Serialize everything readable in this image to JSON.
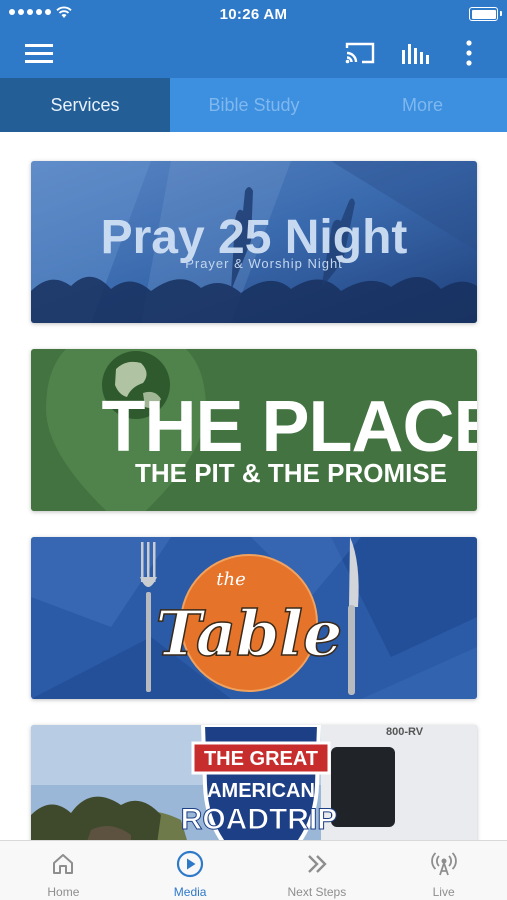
{
  "status_bar": {
    "time": "10:26 AM"
  },
  "top_tabs": [
    {
      "label": "Services",
      "active": true
    },
    {
      "label": "Bible Study",
      "active": false
    },
    {
      "label": "More",
      "active": false
    }
  ],
  "cards": [
    {
      "title": "Pray 25 Night",
      "subtitle": "Prayer & Worship Night"
    },
    {
      "title": "THE PLACE",
      "subtitle": "THE PIT & THE PROMISE"
    },
    {
      "title": "Table",
      "subtitle": "the"
    },
    {
      "title": "ROADTRIP",
      "subtitle_1": "THE GREAT",
      "subtitle_2": "AMERICAN",
      "sign": "800-RV"
    }
  ],
  "bottom_nav": [
    {
      "label": "Home",
      "icon": "home-icon",
      "active": false
    },
    {
      "label": "Media",
      "icon": "play-circle-icon",
      "active": true
    },
    {
      "label": "Next Steps",
      "icon": "double-chevron-right-icon",
      "active": false
    },
    {
      "label": "Live",
      "icon": "broadcast-icon",
      "active": false
    }
  ],
  "colors": {
    "primary": "#2f79c9",
    "tab_active": "#235e97",
    "tab_bg": "#3d8fe0",
    "nav_active": "#2f79c9"
  }
}
